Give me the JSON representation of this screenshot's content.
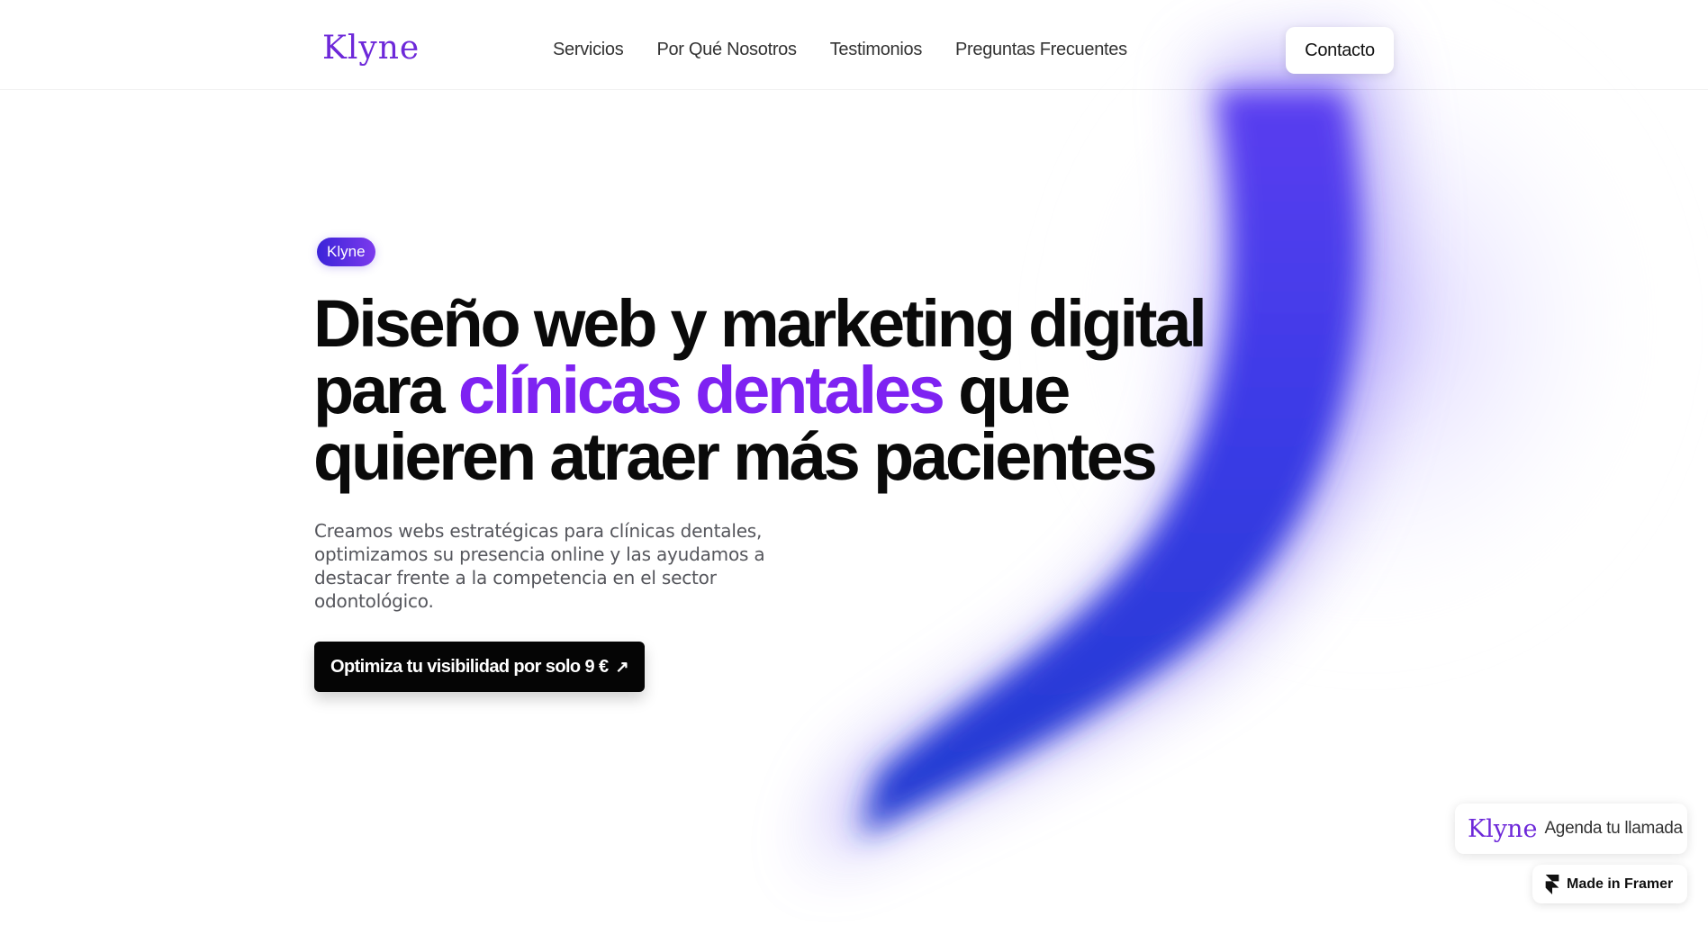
{
  "brand": {
    "logo": "Klyne",
    "accent_color": "#7e22f2",
    "logo_color": "#6d28d9"
  },
  "nav": {
    "items": [
      {
        "label": "Servicios"
      },
      {
        "label": "Por Qué Nosotros"
      },
      {
        "label": "Testimonios"
      },
      {
        "label": "Preguntas Frecuentes"
      }
    ],
    "contact_label": "Contacto"
  },
  "hero": {
    "badge": "Klyne",
    "headline": {
      "line1": "Diseño web y marketing digital",
      "line2_start": "para ",
      "line2_accent": "clínicas dentales",
      "line2_end": " que",
      "line3": "quieren atraer más pacientes"
    },
    "subtitle": "Creamos webs estratégicas para clínicas dentales, optimizamos su presencia online y las ayudamos a destacar frente a la competencia en el sector odontológico.",
    "cta_label": "Optimiza tu visibilidad por solo 9 €",
    "cta_icon": "arrow-up-right-icon"
  },
  "widgets": {
    "call_logo": "Klyne",
    "call_label": "Agenda tu llamada",
    "framer_label": "Made in Framer",
    "framer_icon": "framer-icon"
  }
}
